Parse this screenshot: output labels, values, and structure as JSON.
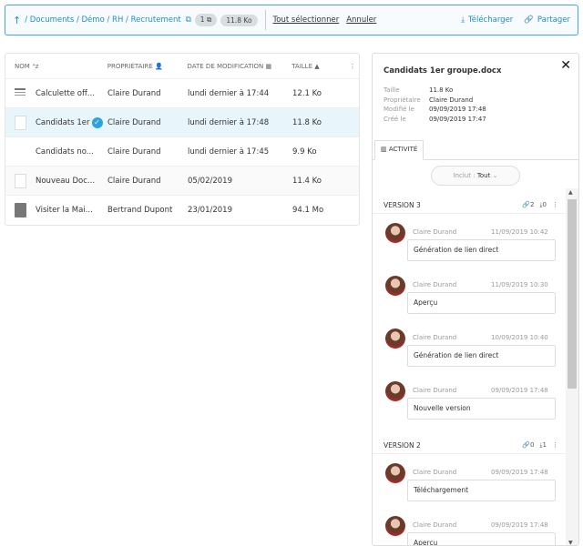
{
  "breadcrumb": {
    "path": "/ Documents / Démo / RH / Recrutement",
    "count": "1",
    "size": "11.8 Ko"
  },
  "toolbar": {
    "select_all": "Tout sélectionner",
    "cancel": "Annuler",
    "download": "Télécharger",
    "share": "Partager"
  },
  "list": {
    "columns": [
      "NOM",
      "PROPRIÉTAIRE",
      "DATE DE MODIFICATION",
      "TAILLE"
    ],
    "rows": [
      {
        "name": "Calculette off...",
        "owner": "Claire Durand",
        "date": "lundi dernier à 17:44",
        "size": "12.1 Ko",
        "icon": "lines"
      },
      {
        "name": "Candidats 1er",
        "owner": "Claire Durand",
        "date": "lundi dernier à 17:48",
        "size": "11.8 Ko",
        "icon": "doc"
      },
      {
        "name": "Candidats no...",
        "owner": "Claire Durand",
        "date": "lundi dernier à 17:45",
        "size": "9.9 Ko",
        "icon": "none"
      },
      {
        "name": "Nouveau Doc...",
        "owner": "Claire Durand",
        "date": "05/02/2019",
        "size": "11.4 Ko",
        "icon": "doc"
      },
      {
        "name": "Visiter la Mai...",
        "owner": "Bertrand Dupont",
        "date": "23/01/2019",
        "size": "94.1 Mo",
        "icon": "video"
      }
    ]
  },
  "panel": {
    "title": "Candidats 1er groupe.docx",
    "meta": [
      {
        "k": "Taille",
        "v": "11.8 Ko"
      },
      {
        "k": "Propriétaire",
        "v": "Claire Durand"
      },
      {
        "k": "Modifié le",
        "v": "09/09/2019 17:48"
      },
      {
        "k": "Créé le",
        "v": "09/09/2019 17:47"
      }
    ],
    "tab": "ACTIVITÉ",
    "filter_label": "Inclut :",
    "filter_value": "Tout",
    "versions": [
      {
        "label": "VERSION 3",
        "links": "2",
        "downloads": "0"
      },
      {
        "label": "VERSION 2",
        "links": "0",
        "downloads": "1"
      }
    ],
    "v3_entries": [
      {
        "user": "Claire Durand",
        "date": "11/09/2019 10:42",
        "action": "Génération de lien direct"
      },
      {
        "user": "Claire Durand",
        "date": "11/09/2019 10:30",
        "action": "Aperçu"
      },
      {
        "user": "Claire Durand",
        "date": "10/09/2019 10:40",
        "action": "Génération de lien direct"
      },
      {
        "user": "Claire Durand",
        "date": "09/09/2019 17:48",
        "action": "Nouvelle version"
      }
    ],
    "v2_entries": [
      {
        "user": "Claire Durand",
        "date": "09/09/2019 17:48",
        "action": "Téléchargement"
      },
      {
        "user": "Claire Durand",
        "date": "09/09/2019 17:48",
        "action": "Aperçu"
      }
    ]
  }
}
